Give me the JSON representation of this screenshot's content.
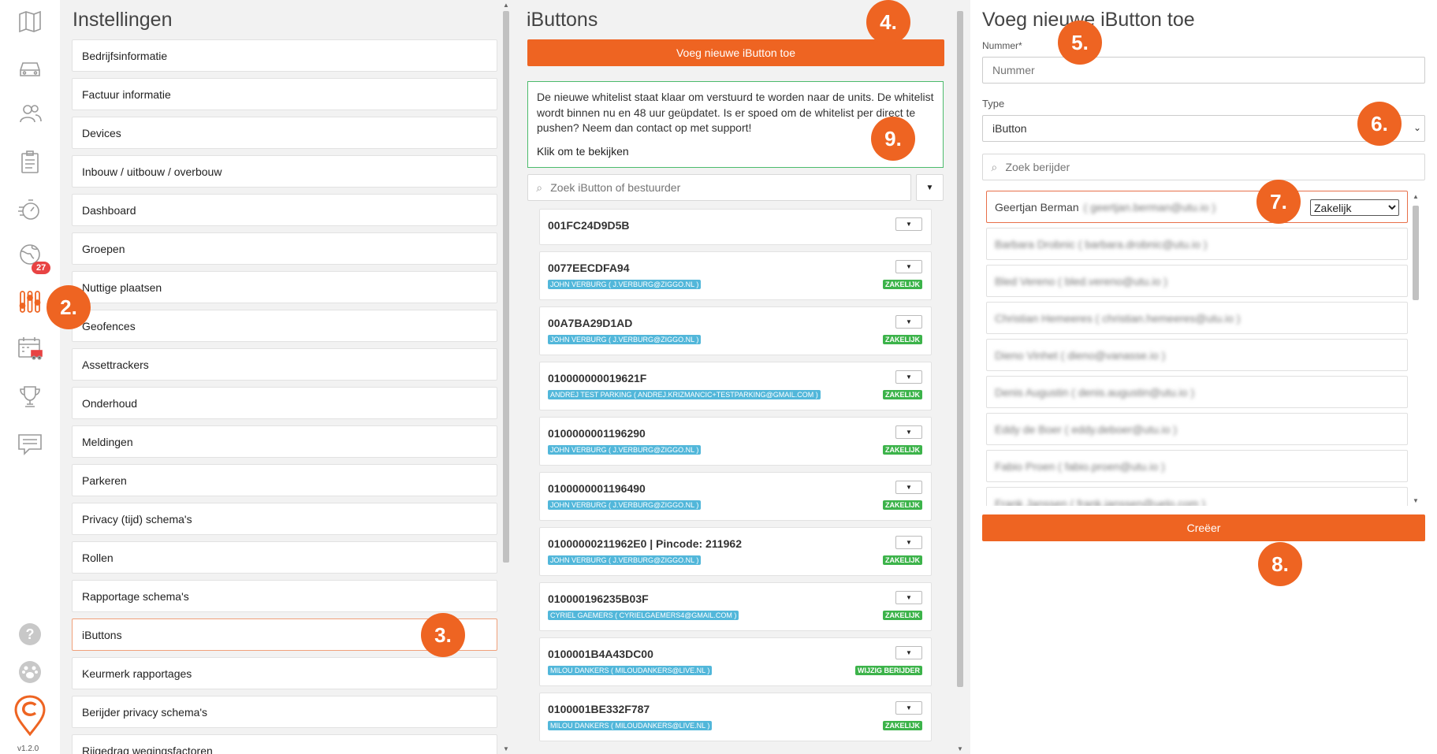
{
  "rail": {
    "icons": [
      "map-icon",
      "car-icon",
      "users-icon",
      "clipboard-icon",
      "stopwatch-icon",
      "globe-icon",
      "sliders-icon",
      "calendar-truck-icon",
      "trophy-icon",
      "chat-icon",
      "help-icon",
      "paw-icon",
      "logo-icon"
    ],
    "badge": "27",
    "version": "v1.2.0"
  },
  "steps": {
    "s2": "2.",
    "s3": "3.",
    "s4": "4.",
    "s5": "5.",
    "s6": "6.",
    "s7": "7.",
    "s8": "8.",
    "s9": "9."
  },
  "settings": {
    "title": "Instellingen",
    "items": [
      "Bedrijfsinformatie",
      "Factuur informatie",
      "Devices",
      "Inbouw / uitbouw / overbouw",
      "Dashboard",
      "Groepen",
      "Nuttige plaatsen",
      "Geofences",
      "Assettrackers",
      "Onderhoud",
      "Meldingen",
      "Parkeren",
      "Privacy (tijd) schema's",
      "Rollen",
      "Rapportage schema's",
      "iButtons",
      "Keurmerk rapportages",
      "Berijder privacy schema's",
      "Rijgedrag wegingsfactoren"
    ],
    "active": "iButtons"
  },
  "ibuttons": {
    "title": "iButtons",
    "add_label": "Voeg nieuwe iButton toe",
    "notice_text": "De nieuwe whitelist staat klaar om verstuurd te worden naar de units. De whitelist wordt binnen nu en 48 uur geüpdatet. Is er spoed om de whitelist per direct te pushen? Neem dan contact op met support!",
    "notice_link": "Klik om te bekijken",
    "search_placeholder": "Zoek iButton of bestuurder",
    "cards": [
      {
        "code": "001FC24D9D5B",
        "driver": "",
        "tag": ""
      },
      {
        "code": "0077EECDFA94",
        "driver": "JOHN VERBURG ( J.VERBURG@ZIGGO.NL )",
        "tag": "ZAKELIJK"
      },
      {
        "code": "00A7BA29D1AD",
        "driver": "JOHN VERBURG ( J.VERBURG@ZIGGO.NL )",
        "tag": "ZAKELIJK"
      },
      {
        "code": "010000000019621F",
        "driver": "ANDREJ TEST PARKING ( ANDREJ.KRIZMANCIC+TESTPARKING@GMAIL.COM )",
        "tag": "ZAKELIJK"
      },
      {
        "code": "0100000001196290",
        "driver": "JOHN VERBURG ( J.VERBURG@ZIGGO.NL )",
        "tag": "ZAKELIJK"
      },
      {
        "code": "0100000001196490",
        "driver": "JOHN VERBURG ( J.VERBURG@ZIGGO.NL )",
        "tag": "ZAKELIJK"
      },
      {
        "code": "01000000211962E0 | Pincode: 211962",
        "driver": "JOHN VERBURG ( J.VERBURG@ZIGGO.NL )",
        "tag": "ZAKELIJK"
      },
      {
        "code": "010000196235B03F",
        "driver": "CYRIEL GAEMERS ( CYRIELGAEMERS4@GMAIL.COM )",
        "tag": "ZAKELIJK"
      },
      {
        "code": "0100001B4A43DC00",
        "driver": "MILOU DANKERS ( MILOUDANKERS@LIVE.NL )",
        "tag": "WIJZIG BERIJDER"
      },
      {
        "code": "0100001BE332F787",
        "driver": "MILOU DANKERS ( MILOUDANKERS@LIVE.NL )",
        "tag": "ZAKELIJK"
      }
    ]
  },
  "new_ibutton": {
    "title": "Voeg nieuwe iButton toe",
    "number_label": "Nummer*",
    "number_placeholder": "Nummer",
    "type_label": "Type",
    "type_value": "iButton",
    "driver_search_placeholder": "Zoek berijder",
    "drivers": [
      {
        "name": "Geertjan Berman",
        "email": "( geertjan.berman@utu.io )",
        "type": "Zakelijk"
      },
      {
        "name": "",
        "email": "Barbara Drobnic ( barbara.drobnic@utu.io )",
        "type": ""
      },
      {
        "name": "",
        "email": "Bled Vereno ( bled.vereno@utu.io )",
        "type": ""
      },
      {
        "name": "",
        "email": "Christian Hemeeres ( christian.hemeeres@utu.io )",
        "type": ""
      },
      {
        "name": "",
        "email": "Dieno Vinhet ( dieno@vanasse.io )",
        "type": ""
      },
      {
        "name": "",
        "email": "Denis Augustin ( denis.augustin@utu.io )",
        "type": ""
      },
      {
        "name": "",
        "email": "Eddy de Boer ( eddy.deboer@utu.io )",
        "type": ""
      },
      {
        "name": "",
        "email": "Fabio Proen ( fabio.proen@utu.io )",
        "type": ""
      },
      {
        "name": "",
        "email": "Frank Janssen ( frank.janssen@uelo.com )",
        "type": ""
      }
    ],
    "create_label": "Creëer"
  }
}
